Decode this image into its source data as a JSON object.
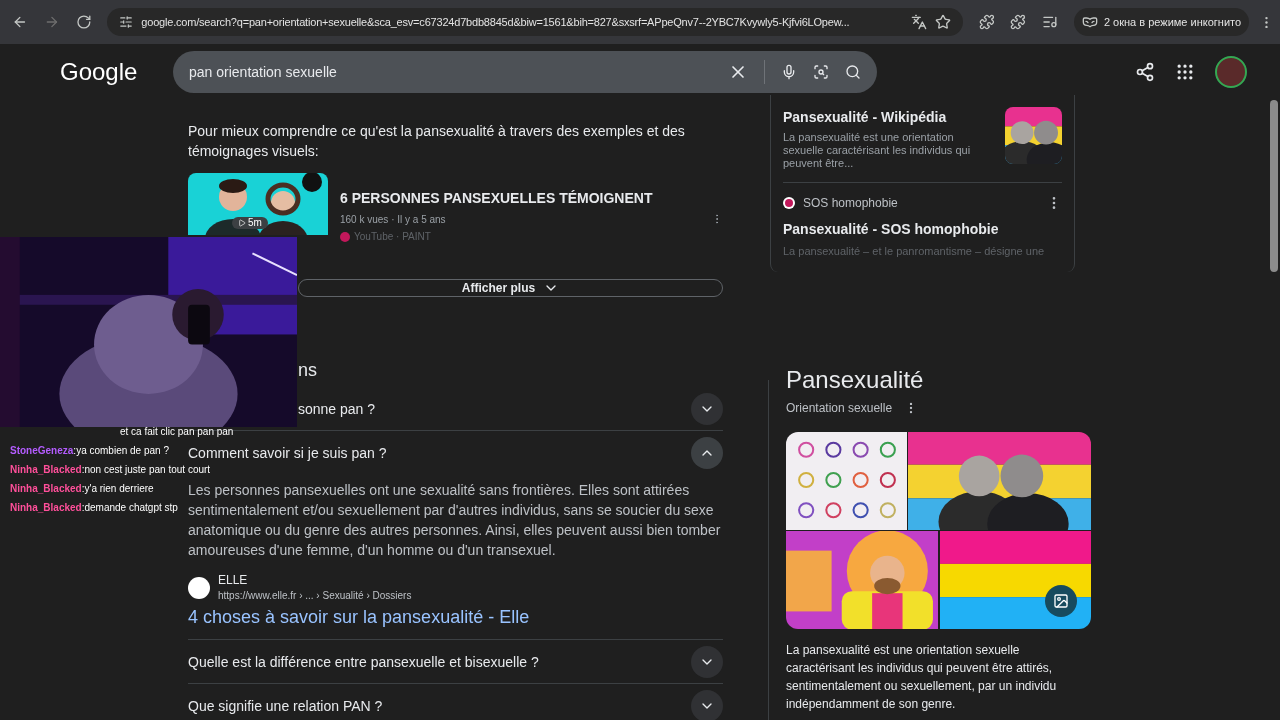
{
  "browser": {
    "url": "google.com/search?q=pan+orientation+sexuelle&sca_esv=c67324d7bdb8845d&biw=1561&bih=827&sxsrf=APpeQnv7--2YBC7Kvywly5-Kjfvi6LOpew...",
    "incognito": "2 окна в режиме инкогнито"
  },
  "header": {
    "logo": "Google",
    "query": "pan orientation sexuelle"
  },
  "intro": "Pour mieux comprendre ce qu'est la pansexualité à travers des exemples et des témoignages visuels:",
  "video": {
    "title": "6 PERSONNES PANSEXUELLES TÉMOIGNENT",
    "meta": "160 k vues · Il y a 5 ans",
    "source": "YouTube · PAINT",
    "duration": "5m"
  },
  "show_more": "Afficher plus",
  "side_results": [
    {
      "kind": "thumb",
      "title": "Pansexualité - Wikipédia",
      "snippet": "La pansexualité est une orientation sexuelle caractérisant les individus qui peuvent être..."
    },
    {
      "kind": "source",
      "source": "SOS homophobie",
      "title": "Pansexualité - SOS homophobie",
      "snippet": "La pansexualité – et le panromantisme – désigne une"
    }
  ],
  "questions": {
    "heading": "ns",
    "items": [
      {
        "question": "sonne pan ?",
        "expanded": false
      },
      {
        "question": "Comment savoir si je suis pan ?",
        "expanded": true,
        "answer": "Les personnes pansexuelles ont une sexualité sans frontières. Elles sont attirées sentimentalement et/ou sexuellement par d'autres individus, sans se soucier du sexe anatomique ou du genre des autres personnes. Ainsi, elles peuvent aussi bien tomber amoureuses d'une femme, d'un homme ou d'un transexuel.",
        "site": "ELLE",
        "url": "https://www.elle.fr › ... › Sexualité › Dossiers",
        "link": "4 choses à savoir sur la pansexualité - Elle"
      },
      {
        "question": "Quelle est la différence entre pansexuelle et bisexuelle ?",
        "expanded": false
      },
      {
        "question": "Que signifie une relation PAN  ?",
        "expanded": false
      }
    ]
  },
  "knowledge": {
    "title": "Pansexualité",
    "subtitle": "Orientation sexuelle",
    "description": "La pansexualité est une orientation sexuelle caractérisant les individus qui peuvent être attirés, sentimentalement ou sexuellement, par un individu indépendamment de son genre."
  },
  "chat": [
    {
      "message": "et ca fait clic pan pan pan"
    },
    {
      "user": "StoneGeneza",
      "color": "#b45cff",
      "message": ":ya combien de pan ?"
    },
    {
      "user": "Ninha_Blacked",
      "color": "#ff4f9a",
      "message": ":non cest juste pan tout court"
    },
    {
      "user": "Ninha_Blacked",
      "color": "#ff4f9a",
      "message": ":y'a rien derriere"
    },
    {
      "user": "Ninha_Blacked",
      "color": "#ff4f9a",
      "message": ":demande chatgpt stp"
    }
  ]
}
